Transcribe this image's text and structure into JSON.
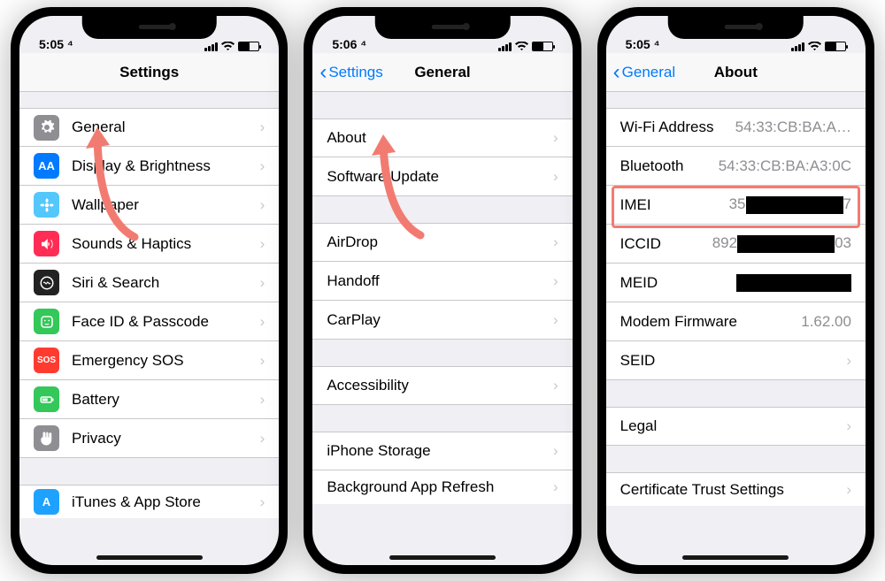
{
  "status": {
    "time_a": "5:05 ⁴",
    "time_b": "5:06 ⁴",
    "time_c": "5:05 ⁴"
  },
  "phoneA": {
    "title": "Settings",
    "rows": [
      {
        "label": "General",
        "color": "#8e8e93",
        "glyph": "gear"
      },
      {
        "label": "Display & Brightness",
        "color": "#007aff",
        "glyph": "AA"
      },
      {
        "label": "Wallpaper",
        "color": "#54c7fc",
        "glyph": "flower"
      },
      {
        "label": "Sounds & Haptics",
        "color": "#ff2d55",
        "glyph": "sound"
      },
      {
        "label": "Siri & Search",
        "color": "#222",
        "glyph": "siri"
      },
      {
        "label": "Face ID & Passcode",
        "color": "#34c759",
        "glyph": "face"
      },
      {
        "label": "Emergency SOS",
        "color": "#ff3b30",
        "glyph": "SOS"
      },
      {
        "label": "Battery",
        "color": "#34c759",
        "glyph": "battery"
      },
      {
        "label": "Privacy",
        "color": "#8e8e93",
        "glyph": "hand"
      }
    ],
    "rows2": [
      {
        "label": "iTunes & App Store",
        "color": "#1fa2ff",
        "glyph": "A"
      }
    ]
  },
  "phoneB": {
    "back": "Settings",
    "title": "General",
    "group1": [
      "About",
      "Software Update"
    ],
    "group2": [
      "AirDrop",
      "Handoff",
      "CarPlay"
    ],
    "group3": [
      "Accessibility"
    ],
    "group4": [
      "iPhone Storage",
      "Background App Refresh"
    ]
  },
  "phoneC": {
    "back": "General",
    "title": "About",
    "rows": [
      {
        "label": "Wi-Fi Address",
        "value": "54:33:CB:BA:A…",
        "redact": false
      },
      {
        "label": "Bluetooth",
        "value": "54:33:CB:BA:A3:0C",
        "redact": false
      },
      {
        "label": "IMEI",
        "value": "35",
        "redact": true,
        "trail": "7"
      },
      {
        "label": "ICCID",
        "value": "892",
        "redact": true,
        "trail": "03"
      },
      {
        "label": "MEID",
        "value": "",
        "redact": true,
        "trail": ""
      },
      {
        "label": "Modem Firmware",
        "value": "1.62.00",
        "redact": false
      },
      {
        "label": "SEID",
        "value": "",
        "redact": false
      }
    ],
    "rows2": [
      {
        "label": "Legal"
      }
    ],
    "rows3": [
      {
        "label": "Certificate Trust Settings"
      }
    ]
  }
}
